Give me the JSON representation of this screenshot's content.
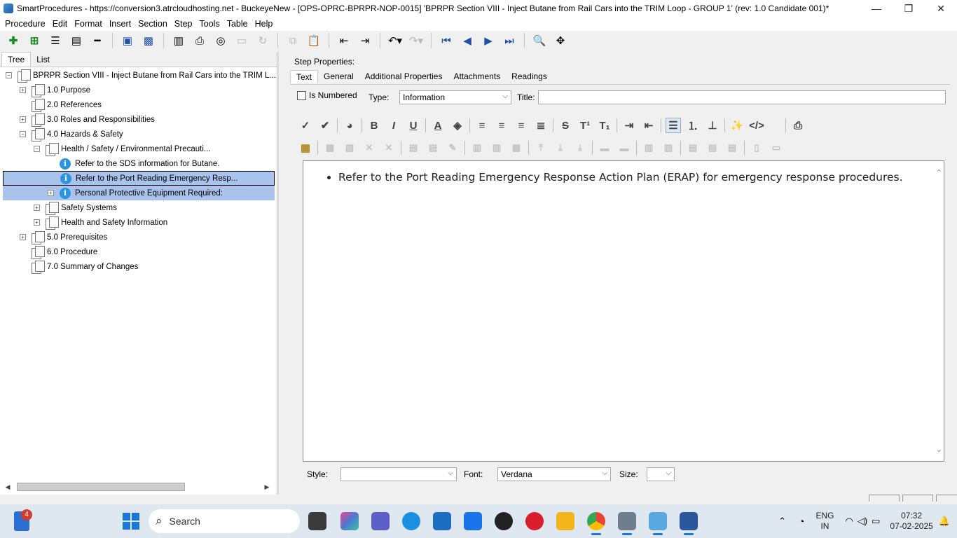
{
  "window": {
    "title": "SmartProcedures - https://conversion3.atrcloudhosting.net - BuckeyeNew - [OPS-OPRC-BPRPR-NOP-0015] 'BPRPR Section VIII - Inject Butane from Rail Cars into the TRIM Loop - GROUP 1' (rev: 1.0 Candidate 001)*",
    "minimize": "—",
    "restore": "❐",
    "close": "✕"
  },
  "menu": [
    "Procedure",
    "Edit",
    "Format",
    "Insert",
    "Section",
    "Step",
    "Tools",
    "Table",
    "Help"
  ],
  "left_tabs": [
    "Tree",
    "List"
  ],
  "tree": [
    {
      "label": "BPRPR Section VIII - Inject Butane from Rail Cars into the TRIM L...",
      "exp": "−"
    },
    {
      "label": "1.0 Purpose",
      "exp": "+"
    },
    {
      "label": "2.0 References",
      "exp": ""
    },
    {
      "label": "3.0 Roles and Responsibilities",
      "exp": "+"
    },
    {
      "label": "4.0 Hazards & Safety",
      "exp": "−"
    },
    {
      "label": "Health / Safety / Environmental Precauti...",
      "exp": "−"
    },
    {
      "label": "Refer to the SDS information for Butane.",
      "exp": ""
    },
    {
      "label": "Refer to the Port Reading Emergency Resp...",
      "exp": ""
    },
    {
      "label": "Personal Protective Equipment Required:",
      "exp": "+"
    },
    {
      "label": "Safety Systems",
      "exp": "+"
    },
    {
      "label": "Health and Safety Information",
      "exp": "+"
    },
    {
      "label": "5.0 Prerequisites",
      "exp": "+"
    },
    {
      "label": "6.0 Procedure",
      "exp": ""
    },
    {
      "label": "7.0 Summary of Changes",
      "exp": ""
    }
  ],
  "step_properties_label": "Step Properties:",
  "right_tabs": [
    "Text",
    "General",
    "Additional Properties",
    "Attachments",
    "Readings"
  ],
  "is_numbered_label": "Is Numbered",
  "type_label": "Type:",
  "type_value": "Information",
  "title_label": "Title:",
  "title_value": "",
  "editor_text": "Refer to the Port Reading Emergency Response Action Plan (ERAP) for emergency response procedures.",
  "bottom": {
    "style_label": "Style:",
    "style_value": "",
    "font_label": "Font:",
    "font_value": "Verdana",
    "size_label": "Size:",
    "size_value": ""
  },
  "dropdown_glyph": "⌵",
  "taskbar": {
    "badge": "4",
    "search": "Search",
    "lang1": "ENG",
    "lang2": "IN",
    "time": "07:32",
    "date": "07-02-2025"
  },
  "icons": {
    "toolbar": [
      "add-icon",
      "add-child-icon",
      "collapse-icon",
      "expand-icon",
      "remove-icon",
      "save-all-icon",
      "save-icon",
      "publish-icon",
      "print-icon",
      "link-icon",
      "image-icon",
      "redo-disabled-icon",
      "copy-icon",
      "paste-icon",
      "outdent-icon",
      "indent-icon",
      "undo-icon",
      "redo-icon",
      "first-icon",
      "prev-icon",
      "next-icon",
      "last-icon",
      "find-icon",
      "move-icon"
    ]
  },
  "colors": {
    "selection": "#a9c3ec",
    "accent_blue": "#1f4fa8",
    "info_icon": "#2a94e0"
  }
}
